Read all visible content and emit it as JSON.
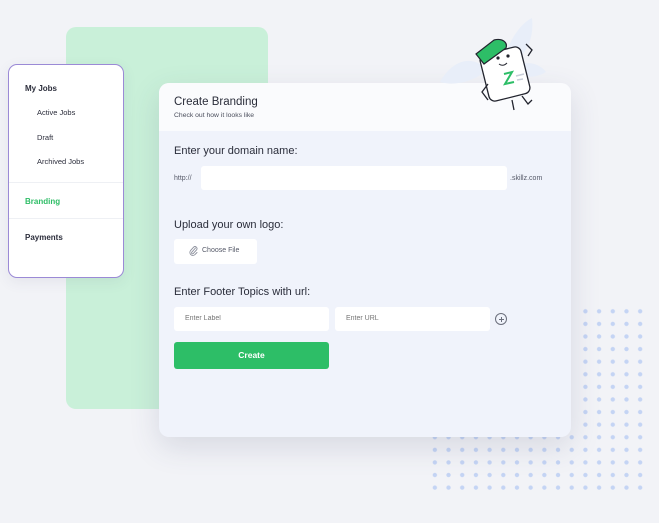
{
  "sidebar": {
    "items": [
      {
        "label": "My Jobs"
      },
      {
        "label": "Active Jobs"
      },
      {
        "label": "Draft"
      },
      {
        "label": "Archived Jobs"
      },
      {
        "label": "Branding"
      },
      {
        "label": "Payments"
      }
    ],
    "active_color": "#2ebd66"
  },
  "card": {
    "title": "Create Branding",
    "subtitle": "Check out how it looks like"
  },
  "domain": {
    "label": "Enter your domain name:",
    "prefix": "http://",
    "suffix": ".skillz.com",
    "value": ""
  },
  "logo": {
    "label": "Upload your own logo:",
    "button": "Choose File"
  },
  "footer": {
    "label": "Enter Footer Topics with url:",
    "label_placeholder": "Enter Label",
    "url_placeholder": "Enter URL"
  },
  "create_button": "Create",
  "colors": {
    "accent": "#2dbe67",
    "panel": "#c9f0d9",
    "sidebar_border": "#9b8ad6"
  },
  "icons": [
    "paperclip-icon",
    "plus-circle-icon",
    "mascot-illustration"
  ]
}
